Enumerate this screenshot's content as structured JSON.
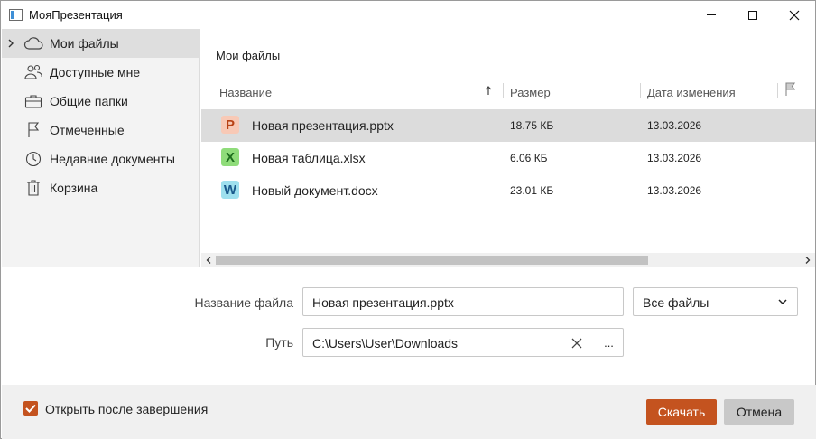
{
  "window": {
    "title": "МояПрезентация"
  },
  "sidebar": {
    "items": [
      {
        "label": "Мои файлы",
        "icon": "cloud-icon",
        "active": true
      },
      {
        "label": "Доступные мне",
        "icon": "users-icon",
        "active": false
      },
      {
        "label": "Общие папки",
        "icon": "briefcase-icon",
        "active": false
      },
      {
        "label": "Отмеченные",
        "icon": "flag-icon",
        "active": false
      },
      {
        "label": "Недавние документы",
        "icon": "clock-icon",
        "active": false
      },
      {
        "label": "Корзина",
        "icon": "trash-icon",
        "active": false
      }
    ]
  },
  "main": {
    "folder_title": "Мои файлы",
    "columns": {
      "name": "Название",
      "size": "Размер",
      "modified": "Дата изменения"
    },
    "files": [
      {
        "icon_letter": "P",
        "type": "presentation",
        "name": "Новая презентация.pptx",
        "size": "18.75 КБ",
        "date": "13.03.2026",
        "selected": true
      },
      {
        "icon_letter": "X",
        "type": "spreadsheet",
        "name": "Новая таблица.xlsx",
        "size": "6.06 КБ",
        "date": "13.03.2026",
        "selected": false
      },
      {
        "icon_letter": "W",
        "type": "document",
        "name": "Новый документ.docx",
        "size": "23.01 КБ",
        "date": "13.03.2026",
        "selected": false
      }
    ]
  },
  "form": {
    "filename_label": "Название файла",
    "filename_value": "Новая презентация.pptx",
    "filter_value": "Все файлы",
    "path_label": "Путь",
    "path_value": "C:\\Users\\User\\Downloads",
    "browse_label": "..."
  },
  "footer": {
    "open_after_label": "Открыть после завершения",
    "open_after_checked": true,
    "download_label": "Скачать",
    "cancel_label": "Отмена"
  },
  "colors": {
    "accent": "#c4531f",
    "presentation_icon_bg": "#f8c9b6",
    "presentation_icon_fg": "#b84215",
    "spreadsheet_icon_bg": "#8fdc7a",
    "spreadsheet_icon_fg": "#1e6e1e",
    "document_icon_bg": "#9ee0ee",
    "document_icon_fg": "#1a5a8c"
  }
}
